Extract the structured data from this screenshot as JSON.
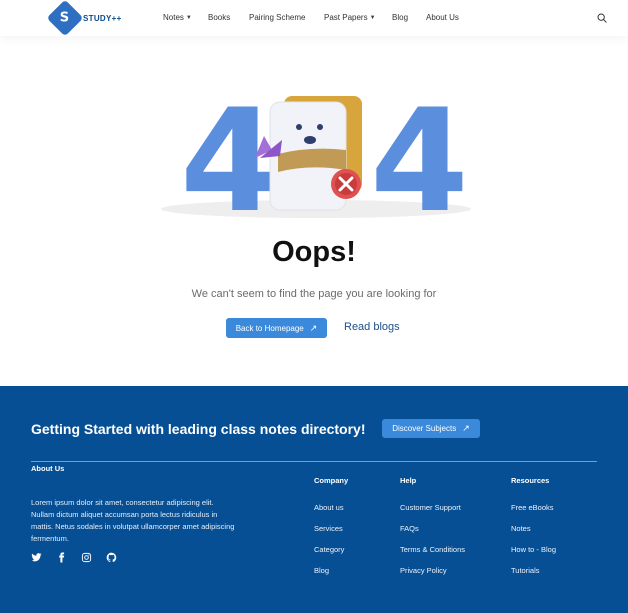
{
  "brand": {
    "logo_letter": "S",
    "name": "STUDY++"
  },
  "nav": {
    "items": [
      {
        "label": "Notes",
        "has_caret": true
      },
      {
        "label": "Books",
        "has_caret": false
      },
      {
        "label": "Pairing Scheme",
        "has_caret": false
      },
      {
        "label": "Past Papers",
        "has_caret": true
      },
      {
        "label": "Blog",
        "has_caret": false
      },
      {
        "label": "About Us",
        "has_caret": false
      }
    ]
  },
  "hero": {
    "digit_left": "4",
    "digit_right": "4",
    "heading": "Oops!",
    "subtext": "We can't seem to find the page you are looking for",
    "primary_button": "Back to Homepage",
    "secondary_link": "Read blogs"
  },
  "footer": {
    "cta_title": "Getting Started with leading class notes directory!",
    "cta_button": "Discover Subjects",
    "about_heading": "About Us",
    "about_text": "Lorem ipsum dolor sit amet, consectetur adipiscing elit. Nullam dictum aliquet accumsan porta lectus ridiculus in mattis. Netus sodales in volutpat ullamcorper amet adipiscing fermentum.",
    "columns": [
      {
        "heading": "Company",
        "links": [
          "About us",
          "Services",
          "Category",
          "Blog"
        ]
      },
      {
        "heading": "Help",
        "links": [
          "Customer Support",
          "FAQs",
          "Terms & Conditions",
          "Privacy Policy"
        ]
      },
      {
        "heading": "Resources",
        "links": [
          "Free eBooks",
          "Notes",
          "How to - Blog",
          "Tutorials"
        ]
      }
    ],
    "social_icons": [
      "twitter-icon",
      "facebook-icon",
      "instagram-icon",
      "github-icon"
    ]
  },
  "colors": {
    "primary_blue": "#3b89db",
    "footer_blue": "#064f94",
    "digit_blue": "#5b8fde",
    "brand_blue": "#2f6fc1"
  }
}
